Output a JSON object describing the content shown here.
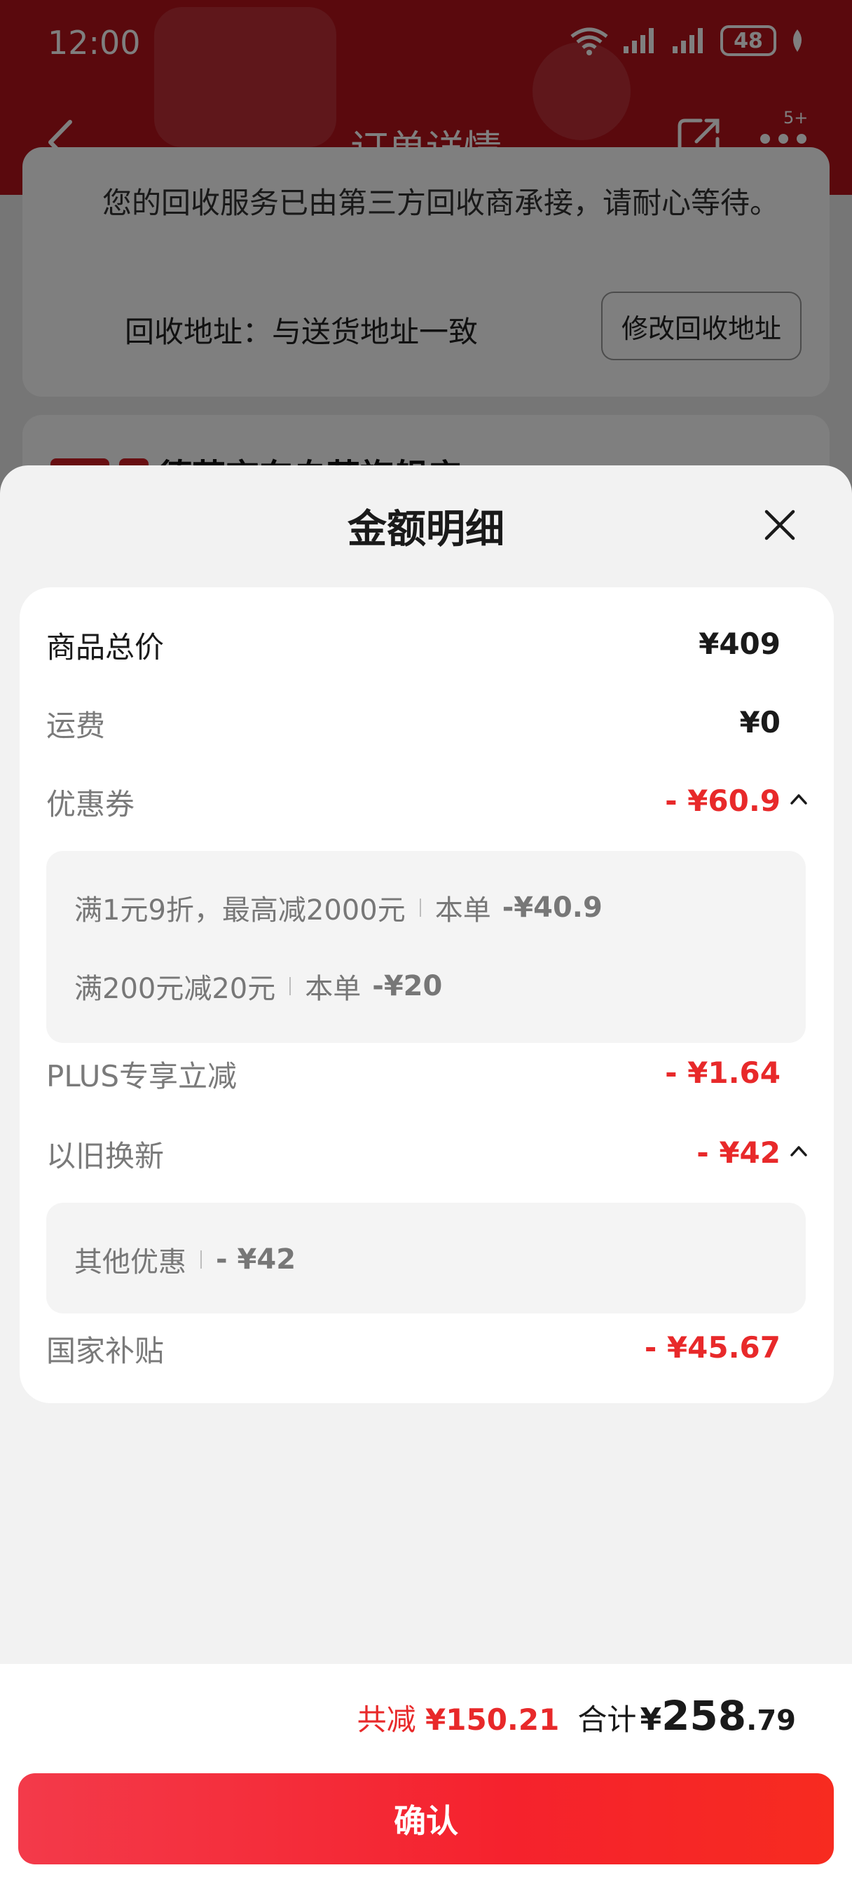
{
  "status_bar": {
    "time": "12:00",
    "battery": "48"
  },
  "nav": {
    "title": "订单详情",
    "badge": "5+"
  },
  "background": {
    "notice": "您的回收服务已由第三方回收商承接，请耐心等待。",
    "address_label": "回收地址：与送货地址一致",
    "address_button": "修改回收地址",
    "store_name": "德芙京东自营旗舰店 ›"
  },
  "sheet": {
    "title": "金额明细",
    "rows": {
      "total_price": {
        "label": "商品总价",
        "value": "¥409"
      },
      "shipping": {
        "label": "运费",
        "value": "¥0"
      },
      "coupon": {
        "label": "优惠券",
        "value": "- ¥60.9"
      },
      "plus": {
        "label": "PLUS专享立减",
        "value": "- ¥1.64"
      },
      "trade_in": {
        "label": "以旧换新",
        "value": "- ¥42"
      },
      "subsidy": {
        "label": "国家补贴",
        "value": "- ¥45.67"
      }
    },
    "coupon_details": [
      {
        "desc": "满1元9折，最高减2000元",
        "scope": "本单",
        "amount": "-¥40.9"
      },
      {
        "desc": "满200元减20元",
        "scope": "本单",
        "amount": "-¥20"
      }
    ],
    "trade_in_details": [
      {
        "desc": "其他优惠",
        "amount": "- ¥42"
      }
    ]
  },
  "footer": {
    "saved_label": "共减",
    "saved_amount": "¥150.21",
    "total_label": "合计",
    "total_currency": "¥",
    "total_integer": "258",
    "total_decimal": ".79",
    "confirm_label": "确认"
  },
  "colors": {
    "accent_red": "#e8292a",
    "header_red": "#b5121b",
    "button_gradient_start": "#f33a4a",
    "button_gradient_end": "#f72b20"
  },
  "icons": [
    "back-arrow-icon",
    "share-icon",
    "more-dots-icon",
    "close-icon",
    "chevron-up-icon",
    "wifi-icon",
    "signal-icon",
    "battery-icon",
    "leaf-icon"
  ]
}
